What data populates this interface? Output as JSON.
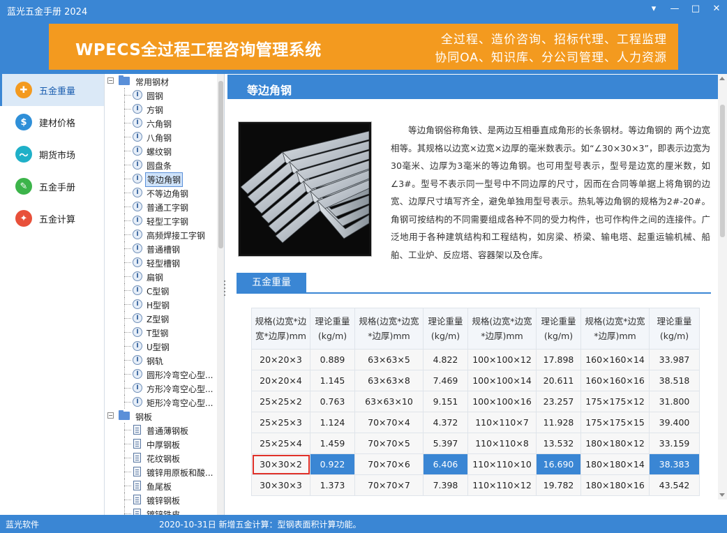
{
  "window": {
    "title": "蓝光五金手册 2024",
    "controls": [
      "▾",
      "—",
      "□",
      "✕"
    ]
  },
  "banner": {
    "main": "WPECS全过程工程咨询管理系统",
    "sub1": "全过程、造价咨询、招标代理、工程监理",
    "sub2": "协同OA、知识库、分公司管理、人力资源",
    "color": "#f39a1f"
  },
  "nav": [
    {
      "label": "五金重量",
      "icon": "cross-icon",
      "color": "#f39a1f",
      "glyph": "✚",
      "active": true
    },
    {
      "label": "建材价格",
      "icon": "dollar-icon",
      "color": "#2f8fd8",
      "glyph": "$",
      "active": false
    },
    {
      "label": "期货市场",
      "icon": "chart-icon",
      "color": "#1fb0c8",
      "glyph": "〜",
      "active": false
    },
    {
      "label": "五金手册",
      "icon": "wrench-icon",
      "color": "#3cb44a",
      "glyph": "✎",
      "active": false
    },
    {
      "label": "五金计算",
      "icon": "wand-icon",
      "color": "#e8503a",
      "glyph": "✦",
      "active": false
    }
  ],
  "tree": {
    "categories": [
      {
        "label": "常用钢材",
        "toggle": "−",
        "leaf_icon": "I",
        "items": [
          "圆钢",
          "方钢",
          "六角钢",
          "八角钢",
          "螺纹钢",
          "圆盘条",
          "等边角钢",
          "不等边角钢",
          "普通工字钢",
          "轻型工字钢",
          "高频焊接工字钢",
          "普通槽钢",
          "轻型槽钢",
          "扁钢",
          "C型钢",
          "H型钢",
          "Z型钢",
          "T型钢",
          "U型钢",
          "钢轨",
          "圆形冷弯空心型...",
          "方形冷弯空心型...",
          "矩形冷弯空心型..."
        ]
      },
      {
        "label": "钢板",
        "toggle": "−",
        "leaf_icon": "doc",
        "items": [
          "普通薄钢板",
          "中厚钢板",
          "花纹钢板",
          "镀锌用原板和酸...",
          "鱼尾板",
          "镀锌钢板",
          "镀锌铁皮"
        ]
      }
    ],
    "selected": "等边角钢"
  },
  "content": {
    "header": "等边角钢",
    "description": "等边角钢俗称角铁、是两边互相垂直成角形的长条钢材。等边角钢的 两个边宽相等。其规格以边宽×边宽×边厚的毫米数表示。如“∠30×30×3”，即表示边宽为 30毫米、边厚为3毫米的等边角钢。也可用型号表示，型号是边宽的厘米数，如∠3#。型号不表示同一型号中不同边厚的尺寸，因而在合同等单据上将角钢的边宽、边厚尺寸填写齐全，避免单独用型号表示。热轧等边角钢的规格为2#-20#。角钢可按结构的不同需要组成各种不同的受力构件，也可作构件之间的连接件。广泛地用于各种建筑结构和工程结构，如房梁、桥梁、输电塔、起重运输机械、船舶、工业炉、反应塔、容器架以及仓库。",
    "section_tab": "五金重量",
    "table": {
      "headers": [
        "规格(边宽*边宽*边厚)mm",
        "理论重量(kg/m)",
        "规格(边宽*边宽*边厚)mm",
        "理论重量(kg/m)",
        "规格(边宽*边宽*边厚)mm",
        "理论重量(kg/m)",
        "规格(边宽*边宽*边厚)mm",
        "理论重量(kg/m)"
      ],
      "rows": [
        [
          "20×20×3",
          "0.889",
          "63×63×5",
          "4.822",
          "100×100×12",
          "17.898",
          "160×160×14",
          "33.987"
        ],
        [
          "20×20×4",
          "1.145",
          "63×63×8",
          "7.469",
          "100×100×14",
          "20.611",
          "160×160×16",
          "38.518"
        ],
        [
          "25×25×2",
          "0.763",
          "63×63×10",
          "9.151",
          "100×100×16",
          "23.257",
          "175×175×12",
          "31.800"
        ],
        [
          "25×25×3",
          "1.124",
          "70×70×4",
          "4.372",
          "110×110×7",
          "11.928",
          "175×175×15",
          "39.400"
        ],
        [
          "25×25×4",
          "1.459",
          "70×70×5",
          "5.397",
          "110×110×8",
          "13.532",
          "180×180×12",
          "33.159"
        ],
        [
          "30×30×2",
          "0.922",
          "70×70×6",
          "6.406",
          "110×110×10",
          "16.690",
          "180×180×14",
          "38.383"
        ],
        [
          "30×30×3",
          "1.373",
          "70×70×7",
          "7.398",
          "110×110×12",
          "19.782",
          "180×180×16",
          "43.542"
        ]
      ],
      "highlight_row": 5,
      "boxed_cell": "30×30×2",
      "highlight_color": "#3a86d4"
    }
  },
  "status": {
    "left": "蓝光软件",
    "message": "2020-10-31日 新增五金计算：型钢表面积计算功能。"
  },
  "accent": "#3a86d4"
}
